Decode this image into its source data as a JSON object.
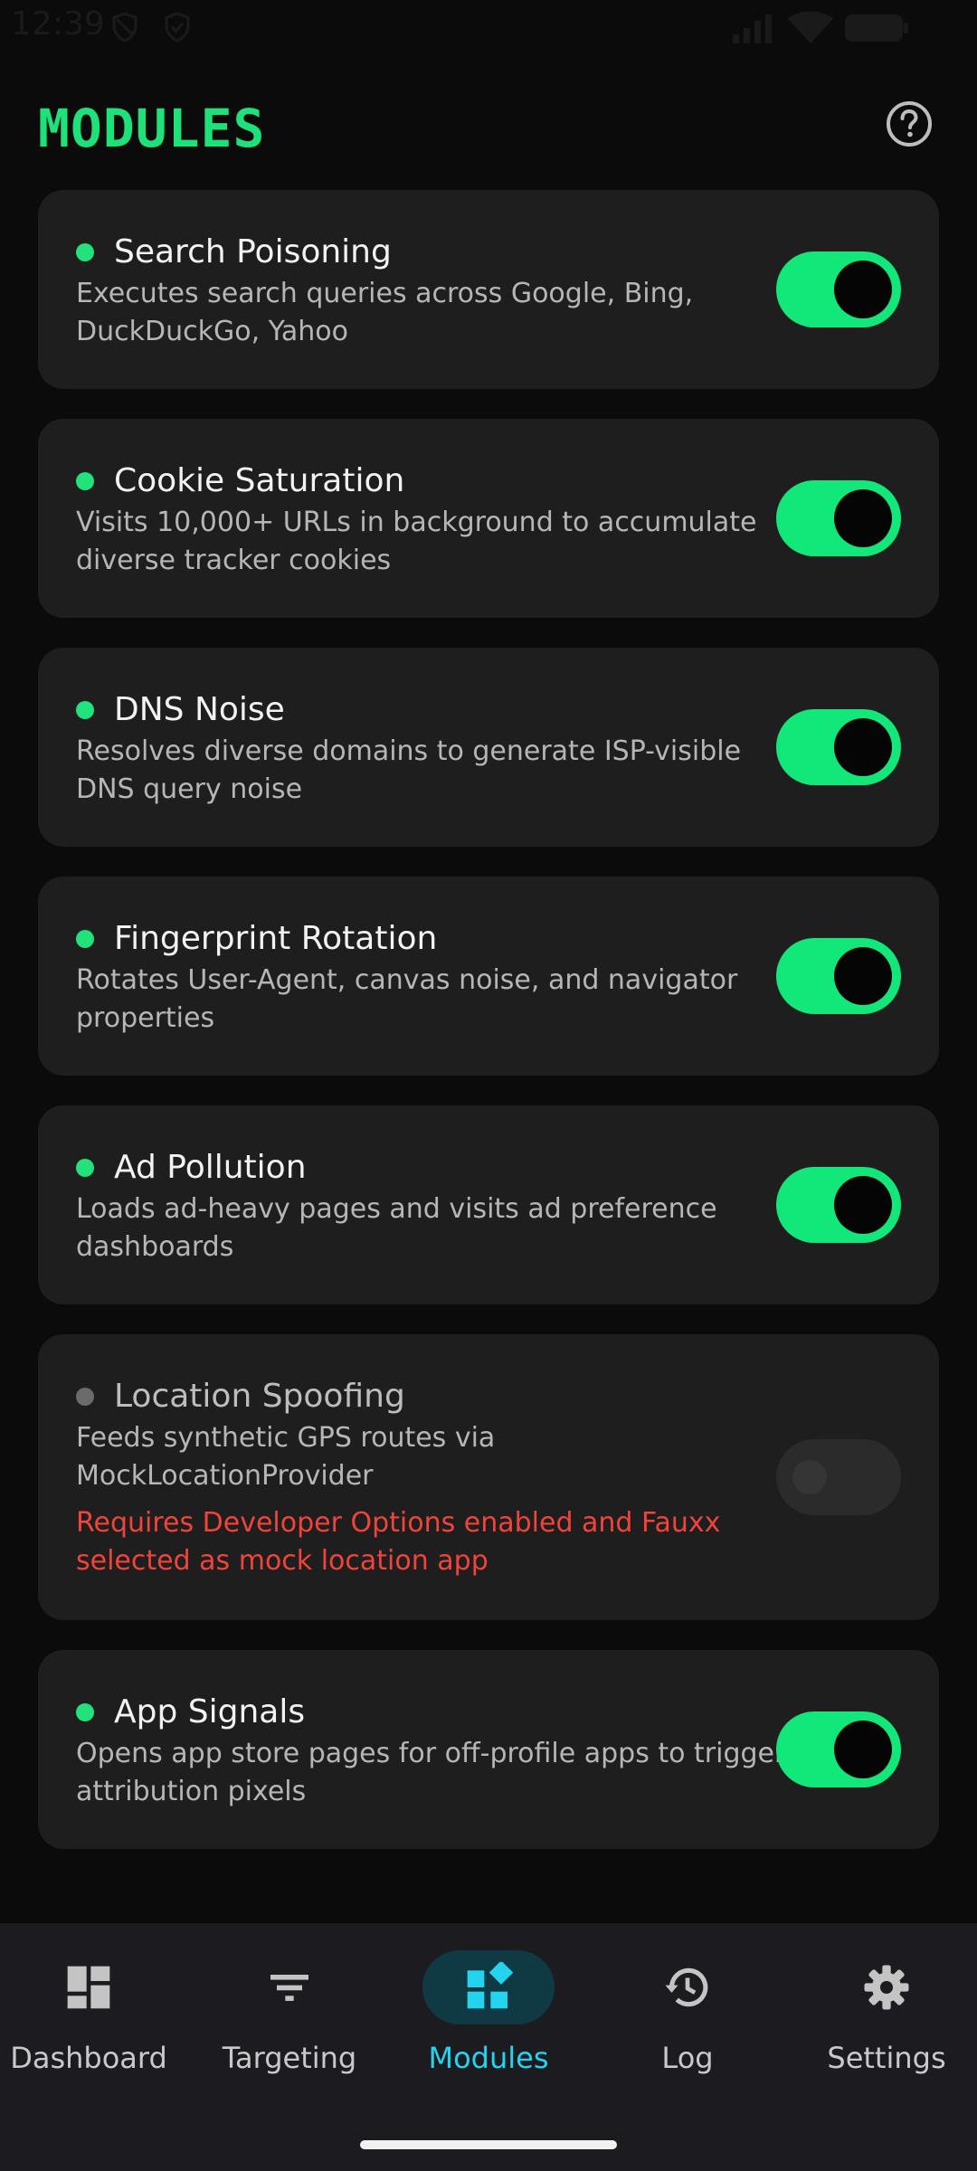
{
  "status_bar": {
    "time": "12:39"
  },
  "header": {
    "title": "MODULES"
  },
  "colors": {
    "accent": "#1de27a",
    "warning": "#f0433a",
    "nav_active": "#24d3ee"
  },
  "modules": [
    {
      "title": "Search Poisoning",
      "description": "Executes search queries across Google, Bing, DuckDuckGo, Yahoo",
      "enabled": true
    },
    {
      "title": "Cookie Saturation",
      "description": "Visits 10,000+ URLs in background to accumulate diverse tracker cookies",
      "enabled": true
    },
    {
      "title": "DNS Noise",
      "description": "Resolves diverse domains to generate ISP-visible DNS query noise",
      "enabled": true
    },
    {
      "title": "Fingerprint Rotation",
      "description": "Rotates User-Agent, canvas noise, and navigator properties",
      "enabled": true
    },
    {
      "title": "Ad Pollution",
      "description": "Loads ad-heavy pages and visits ad preference dashboards",
      "enabled": true
    },
    {
      "title": "Location Spoofing",
      "description": "Feeds synthetic GPS routes via MockLocationProvider",
      "warning": "Requires Developer Options enabled and Fauxx selected as mock location app",
      "enabled": false
    },
    {
      "title": "App Signals",
      "description": "Opens app store pages for off-profile apps to trigger attribution pixels",
      "enabled": true
    }
  ],
  "bottom_nav": {
    "items": [
      {
        "label": "Dashboard",
        "icon": "dashboard-icon"
      },
      {
        "label": "Targeting",
        "icon": "filter-icon"
      },
      {
        "label": "Modules",
        "icon": "widgets-icon",
        "active": true
      },
      {
        "label": "Log",
        "icon": "history-icon"
      },
      {
        "label": "Settings",
        "icon": "gear-icon"
      }
    ]
  }
}
